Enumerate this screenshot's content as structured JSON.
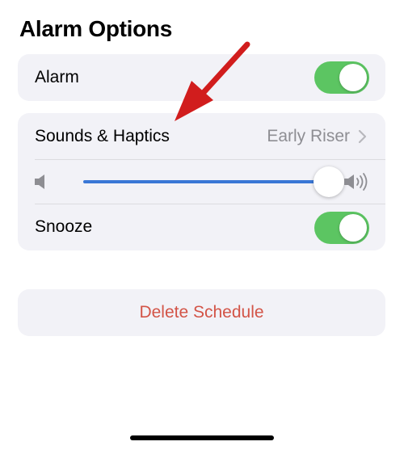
{
  "section": {
    "title": "Alarm Options"
  },
  "alarm_row": {
    "label": "Alarm",
    "toggle_on": true
  },
  "sounds_row": {
    "label": "Sounds & Haptics",
    "value": "Early Riser"
  },
  "volume_slider": {
    "level": 0.98
  },
  "snooze_row": {
    "label": "Snooze",
    "toggle_on": true
  },
  "delete_button": {
    "label": "Delete Schedule"
  },
  "colors": {
    "toggle_on": "#5cc562",
    "slider_fill": "#3a77d6",
    "destructive": "#d35447",
    "annotation_arrow": "#d11d1d",
    "card_bg": "#f2f2f7"
  },
  "icons": {
    "volume_low": "speaker-low-icon",
    "volume_high": "speaker-high-icon",
    "chevron": "chevron-right-icon",
    "annotation": "red-arrow"
  }
}
